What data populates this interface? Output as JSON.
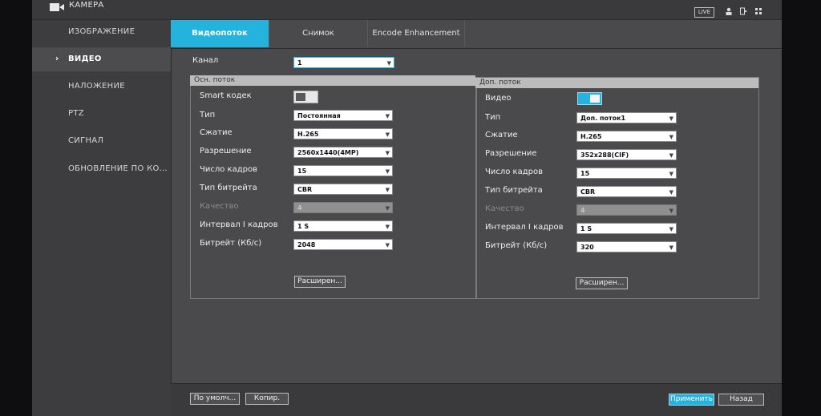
{
  "app": {
    "title": "КАМЕРА",
    "live_label": "LIVE"
  },
  "sidebar": {
    "items": [
      {
        "label": "ИЗОБРАЖЕНИЕ"
      },
      {
        "label": "ВИДЕО",
        "active": true
      },
      {
        "label": "НАЛОЖЕНИЕ"
      },
      {
        "label": "PTZ"
      },
      {
        "label": "СИГНАЛ"
      },
      {
        "label": "ОБНОВЛЕНИЕ ПО КОА..."
      }
    ]
  },
  "tabs": [
    {
      "label": "Видеопоток",
      "active": true
    },
    {
      "label": "Снимок"
    },
    {
      "label": "Encode Enhancement"
    }
  ],
  "channel": {
    "label": "Канал",
    "value": "1"
  },
  "main_stream": {
    "header": "Осн. поток",
    "smart_label": "Smart кодек",
    "smart_on": false,
    "type_label": "Тип",
    "type_value": "Постоянная",
    "compression_label": "Сжатие",
    "compression_value": "H.265",
    "resolution_label": "Разрешение",
    "resolution_value": "2560x1440(4MP)",
    "framerate_label": "Число кадров",
    "framerate_value": "15",
    "bitrate_type_label": "Тип битрейта",
    "bitrate_type_value": "CBR",
    "quality_label": "Качество",
    "quality_value": "4",
    "iframe_label": "Интервал I кадров",
    "iframe_value": "1 S",
    "bitrate_label": "Битрейт (Кб/с)",
    "bitrate_value": "2048",
    "advanced_label": "Расширен..."
  },
  "sub_stream": {
    "header": "Доп. поток",
    "video_label": "Видео",
    "video_on": true,
    "type_label": "Тип",
    "type_value": "Доп. поток1",
    "compression_label": "Сжатие",
    "compression_value": "H.265",
    "resolution_label": "Разрешение",
    "resolution_value": "352x288(CIF)",
    "framerate_label": "Число кадров",
    "framerate_value": "15",
    "bitrate_type_label": "Тип битрейта",
    "bitrate_type_value": "CBR",
    "quality_label": "Качество",
    "quality_value": "4",
    "iframe_label": "Интервал I кадров",
    "iframe_value": "1 S",
    "bitrate_label": "Битрейт (Кб/с)",
    "bitrate_value": "320",
    "advanced_label": "Расширен..."
  },
  "footer": {
    "default_label": "По умолч...",
    "copy_label": "Копир.",
    "apply_label": "Применить",
    "back_label": "Назад"
  },
  "colors": {
    "accent": "#23b3dd",
    "background": "#4a4a4c",
    "sidebar": "#3d3d3f"
  }
}
